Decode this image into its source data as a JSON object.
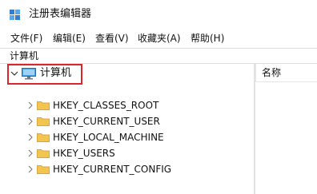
{
  "window": {
    "title": "注册表编辑器"
  },
  "menu": {
    "items": [
      {
        "label": "文件(F)"
      },
      {
        "label": "编辑(E)"
      },
      {
        "label": "查看(V)"
      },
      {
        "label": "收藏夹(A)"
      },
      {
        "label": "帮助(H)"
      }
    ]
  },
  "address": {
    "path": "计算机"
  },
  "tree": {
    "root": {
      "label": "计算机",
      "icon": "computer-icon",
      "expanded": true
    },
    "children": [
      {
        "label": "HKEY_CLASSES_ROOT",
        "icon": "folder-icon"
      },
      {
        "label": "HKEY_CURRENT_USER",
        "icon": "folder-icon"
      },
      {
        "label": "HKEY_LOCAL_MACHINE",
        "icon": "folder-icon"
      },
      {
        "label": "HKEY_USERS",
        "icon": "folder-icon"
      },
      {
        "label": "HKEY_CURRENT_CONFIG",
        "icon": "folder-icon"
      }
    ]
  },
  "list": {
    "columns": [
      {
        "label": "名称"
      }
    ]
  },
  "colors": {
    "highlight": "#d9262b",
    "folder": "#f3c550",
    "folder_dark": "#dba63a"
  }
}
